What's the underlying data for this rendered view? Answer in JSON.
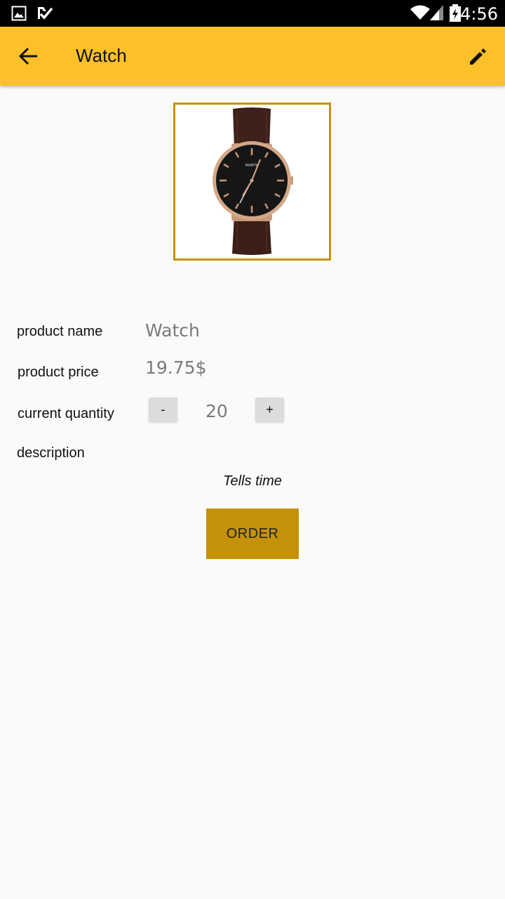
{
  "status_bar": {
    "time": "4:56",
    "icons": [
      "image-icon",
      "check-notification-icon",
      "wifi-icon",
      "signal-icon",
      "battery-charging-icon"
    ]
  },
  "app_bar": {
    "title": "Watch",
    "back_icon": "arrow-back-icon",
    "edit_icon": "edit-pencil-icon",
    "background": "#fcc02a"
  },
  "product": {
    "image_alt": "watch-image",
    "image_brand_text": "MVMTH",
    "name_label": "product name",
    "name_value": "Watch",
    "price_label": "product price",
    "price_value": "19.75$",
    "quantity_label": "current quantity",
    "quantity_value": "20",
    "decrement_label": "-",
    "increment_label": "+",
    "description_label": "description",
    "description_value": "Tells time"
  },
  "order_button": {
    "label": "ORDER",
    "color": "#c49209"
  },
  "colors": {
    "accent": "#fcc02a",
    "frame": "#c49309",
    "background": "#fafafa"
  }
}
